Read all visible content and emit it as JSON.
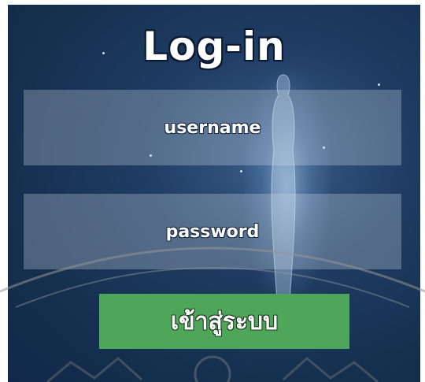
{
  "login": {
    "title": "Log-in",
    "username_placeholder": "username",
    "password_placeholder": "password",
    "submit_label": "เข้าสู่ระบบ"
  },
  "theme": {
    "background": "#15304f",
    "field_fill": "rgba(210,220,232,0.30)",
    "button_color": "#4fa55a",
    "text_color": "#ffffff"
  },
  "icons": [
    "ghost-figure-graphic",
    "seal-watermark"
  ]
}
